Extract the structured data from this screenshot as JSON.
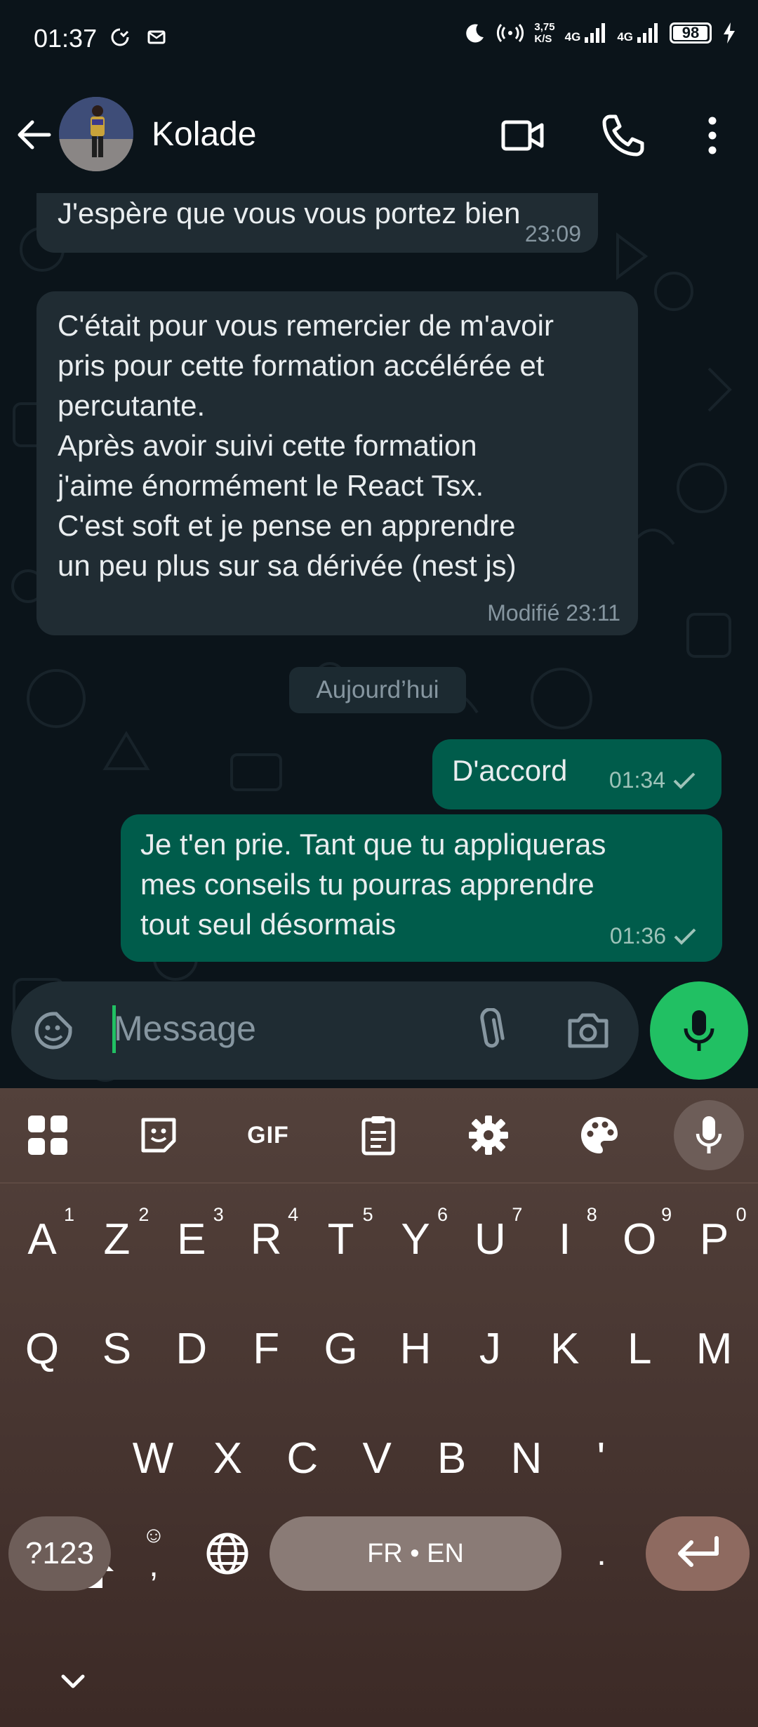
{
  "status_bar": {
    "time": "01:37",
    "speed_value": "3,75",
    "speed_unit": "K/S",
    "network_a": "4G",
    "network_b": "4G",
    "battery": "98",
    "icons": [
      "do-not-disturb-icon",
      "message-icon",
      "moon-icon",
      "hotspot-icon",
      "signal-icon",
      "signal-icon",
      "battery-icon",
      "charging-icon"
    ]
  },
  "header": {
    "contact_name": "Kolade",
    "icons": [
      "back-arrow-icon",
      "avatar",
      "video-call-icon",
      "voice-call-icon",
      "more-options-icon"
    ]
  },
  "messages": [
    {
      "direction": "incoming",
      "text": "J'espère que vous vous portez bien",
      "time": "23:09"
    },
    {
      "direction": "incoming",
      "text": "C'était pour vous remercier de m'avoir\npris pour cette formation accélérée et\npercutante.\nAprès avoir suivi cette formation\nj'aime énormément le React Tsx.\nC'est soft et je pense en apprendre\nun peu plus sur sa dérivée (nest js)",
      "time": "Modifié 23:11"
    },
    {
      "direction": "outgoing",
      "text": "D'accord",
      "time": "01:34"
    },
    {
      "direction": "outgoing",
      "text": "Je t'en prie. Tant que tu appliqueras\nmes conseils tu pourras apprendre\ntout seul désormais",
      "time": "01:36"
    }
  ],
  "date_divider": "Aujourd’hui",
  "composer": {
    "placeholder": "Message",
    "icons": [
      "sticker-icon",
      "attach-icon",
      "camera-icon",
      "mic-icon"
    ]
  },
  "keyboard": {
    "toolbar": [
      "apps-grid-icon",
      "sticker-icon",
      "gif-icon",
      "clipboard-icon",
      "settings-gear-icon",
      "theme-palette-icon",
      "mic-icon"
    ],
    "gif_label": "GIF",
    "row1": [
      {
        "l": "A",
        "h": "1"
      },
      {
        "l": "Z",
        "h": "2"
      },
      {
        "l": "E",
        "h": "3"
      },
      {
        "l": "R",
        "h": "4"
      },
      {
        "l": "T",
        "h": "5"
      },
      {
        "l": "Y",
        "h": "6"
      },
      {
        "l": "U",
        "h": "7"
      },
      {
        "l": "I",
        "h": "8"
      },
      {
        "l": "O",
        "h": "9"
      },
      {
        "l": "P",
        "h": "0"
      }
    ],
    "row2": [
      "Q",
      "S",
      "D",
      "F",
      "G",
      "H",
      "J",
      "K",
      "L",
      "M"
    ],
    "row3": [
      "W",
      "X",
      "C",
      "V",
      "B",
      "N",
      "'"
    ],
    "symbols_key": "?123",
    "comma_key": ",",
    "space_label": "FR • EN",
    "period_key": "."
  },
  "colors": {
    "background": "#0b141a",
    "incoming_bubble": "#202c33",
    "outgoing_bubble": "#005c4b",
    "accent_green": "#21c063",
    "keyboard_bg": "#4a3833"
  }
}
